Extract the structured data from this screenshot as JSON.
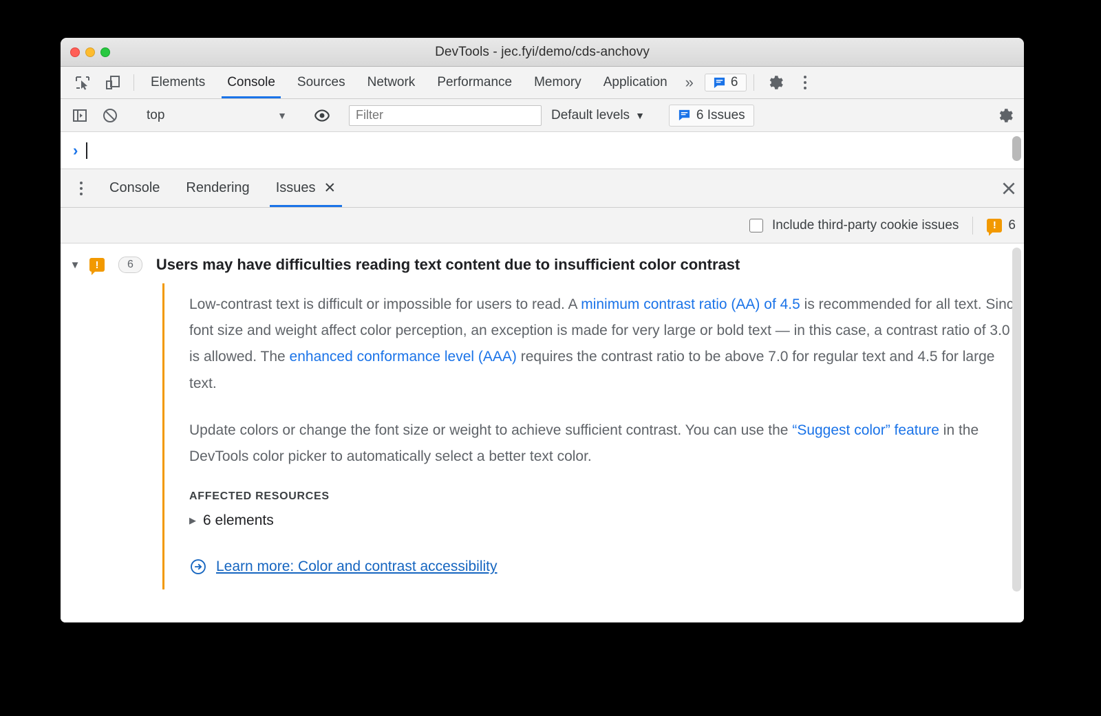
{
  "window": {
    "title": "DevTools - jec.fyi/demo/cds-anchovy"
  },
  "main_tabs": {
    "items": [
      {
        "label": "Elements",
        "active": false
      },
      {
        "label": "Console",
        "active": true
      },
      {
        "label": "Sources",
        "active": false
      },
      {
        "label": "Network",
        "active": false
      },
      {
        "label": "Performance",
        "active": false
      },
      {
        "label": "Memory",
        "active": false
      },
      {
        "label": "Application",
        "active": false
      }
    ],
    "overflow": "»",
    "issues_count": "6"
  },
  "console_toolbar": {
    "context": "top",
    "context_caret": "▼",
    "filter_placeholder": "Filter",
    "levels_label": "Default levels",
    "levels_caret": "▼",
    "issues_button": "6 Issues"
  },
  "console_prompt": {
    "arrow": "›",
    "value": ""
  },
  "drawer": {
    "tabs": [
      {
        "label": "Console",
        "active": false,
        "closable": false
      },
      {
        "label": "Rendering",
        "active": false,
        "closable": false
      },
      {
        "label": "Issues",
        "active": true,
        "closable": true
      }
    ],
    "tab_close": "✕",
    "drawer_close": "✕"
  },
  "issues_toolbar": {
    "checkbox_label": "Include third-party cookie issues",
    "checkbox_checked": false,
    "warning_count": "6"
  },
  "issue": {
    "expander": "▼",
    "badge_glyph": "!",
    "count": "6",
    "title": "Users may have difficulties reading text content due to insufficient color contrast",
    "paragraph1": {
      "t1": "Low-contrast text is difficult or impossible for users to read. A ",
      "link1": "minimum contrast ratio (AA) of 4.5",
      "t2": " is recommended for all text. Since font size and weight affect color perception, an exception is made for very large or bold text — in this case, a contrast ratio of 3.0 is allowed. The ",
      "link2": "enhanced conformance level (AAA)",
      "t3": " requires the contrast ratio to be above 7.0 for regular text and 4.5 for large text."
    },
    "paragraph2": {
      "t1": "Update colors or change the font size or weight to achieve sufficient contrast. You can use the ",
      "link1": "“Suggest color” feature",
      "t2": " in the DevTools color picker to automatically select a better text color."
    },
    "affected_resources_label": "AFFECTED RESOURCES",
    "resource_expander": "▶",
    "resource_label": "6 elements",
    "learn_more": "Learn more: Color and contrast accessibility"
  },
  "colors": {
    "accent_blue": "#1a73e8",
    "link_blue": "#1565c0",
    "warning_orange": "#f29900",
    "toolbar_bg": "#f3f3f3"
  }
}
